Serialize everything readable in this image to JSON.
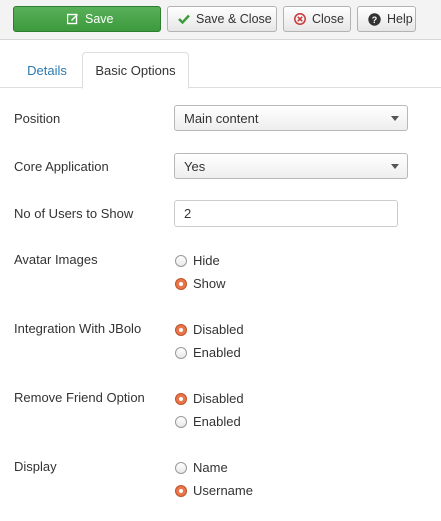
{
  "toolbar": {
    "save_label": "Save",
    "save_close_label": "Save & Close",
    "close_label": "Close",
    "help_label": "Help"
  },
  "tabs": [
    {
      "label": "Details"
    },
    {
      "label": "Basic Options",
      "active": true
    }
  ],
  "form": {
    "position": {
      "label": "Position",
      "value": "Main content"
    },
    "core_application": {
      "label": "Core Application",
      "value": "Yes"
    },
    "users_to_show": {
      "label": "No of Users to Show",
      "value": "2"
    },
    "avatar_images": {
      "label": "Avatar Images",
      "options": [
        "Hide",
        "Show"
      ],
      "selected": "Show"
    },
    "integration_jbolo": {
      "label": "Integration With JBolo",
      "options": [
        "Disabled",
        "Enabled"
      ],
      "selected": "Disabled"
    },
    "remove_friend": {
      "label": "Remove Friend Option",
      "options": [
        "Disabled",
        "Enabled"
      ],
      "selected": "Disabled"
    },
    "display": {
      "label": "Display",
      "options": [
        "Name",
        "Username"
      ],
      "selected": "Username"
    }
  },
  "colors": {
    "save_green": "#46a546",
    "accent_link": "#2a7ab0",
    "radio_selected": "#e8764a"
  }
}
